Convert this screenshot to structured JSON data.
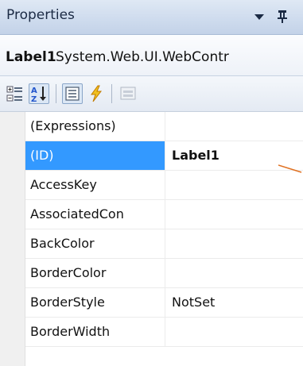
{
  "panel": {
    "title": "Properties",
    "dropdown_icon": "dropdown-arrow-icon",
    "pin_icon": "pin-icon"
  },
  "object_selector": {
    "name": "Label1",
    "type": "System.Web.UI.WebContr"
  },
  "toolbar": {
    "buttons": [
      {
        "icon": "categorized-icon",
        "active": false
      },
      {
        "icon": "alphabetical-icon",
        "active": true
      },
      {
        "icon": "properties-icon",
        "active": true
      },
      {
        "icon": "events-icon",
        "active": false
      },
      {
        "icon": "property-pages-icon",
        "active": false
      }
    ]
  },
  "properties": [
    {
      "name": "(Expressions)",
      "value": ""
    },
    {
      "name": "(ID)",
      "value": "Label1",
      "selected": true
    },
    {
      "name": "AccessKey",
      "value": ""
    },
    {
      "name": "AssociatedCon",
      "value": ""
    },
    {
      "name": "BackColor",
      "value": ""
    },
    {
      "name": "BorderColor",
      "value": ""
    },
    {
      "name": "BorderStyle",
      "value": "NotSet"
    },
    {
      "name": "BorderWidth",
      "value": ""
    }
  ],
  "colors": {
    "selection": "#3399ff",
    "annotation": "#e07020",
    "title_bar": "#cfdcee"
  }
}
